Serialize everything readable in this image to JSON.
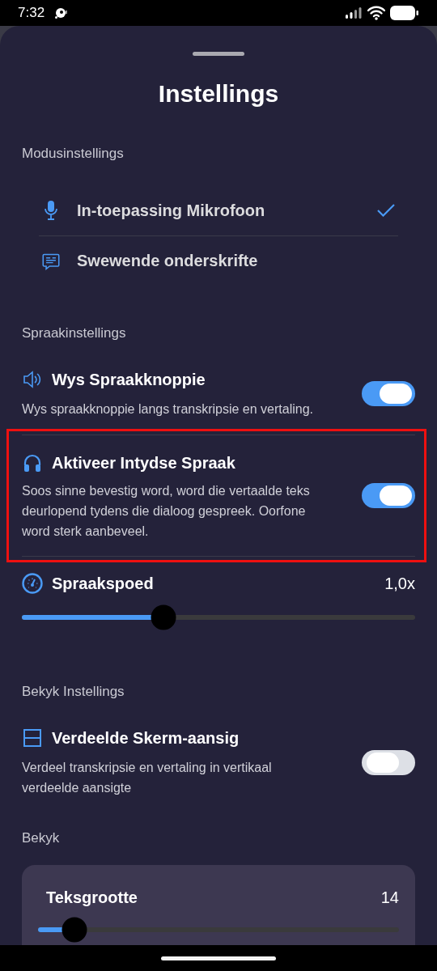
{
  "status_bar": {
    "time": "7:32"
  },
  "sheet": {
    "title": "Instellings"
  },
  "sections": [
    {
      "kind": "modes",
      "heading": "Modusinstellings",
      "options": [
        {
          "label": "In-toepassing Mikrofoon",
          "selected": true
        },
        {
          "label": "Swewende onderskrifte",
          "selected": false
        }
      ]
    },
    {
      "kind": "rows",
      "heading": "Spraakinstellings",
      "rows": [
        {
          "kind": "toggle",
          "title": "Wys Spraakknoppie",
          "description": "Wys spraakknoppie langs transkripsie en vertaling.",
          "on": true,
          "highlighted": false
        },
        {
          "kind": "toggle",
          "title": "Aktiveer Intydse Spraak",
          "description": "Soos sinne bevestig word, word die vertaalde teks deurlopend tydens die dialoog gespreek. Oorfone word sterk aanbeveel.",
          "on": true,
          "highlighted": true
        },
        {
          "kind": "slider",
          "title": "Spraakspoed",
          "value": "1,0x",
          "level": 0.36
        }
      ]
    },
    {
      "kind": "rows",
      "heading": "Bekyk Instellings",
      "rows": [
        {
          "kind": "toggle",
          "title": "Verdeelde Skerm-aansig",
          "description": "Verdeel transkripsie en vertaling in vertikaal verdeelde aansigte",
          "on": false,
          "highlighted": false
        }
      ]
    },
    {
      "kind": "card",
      "heading": "Bekyk",
      "rows": [
        {
          "kind": "slider",
          "title": "Teksgrootte",
          "value": "14",
          "level": 0.1
        }
      ]
    }
  ]
}
